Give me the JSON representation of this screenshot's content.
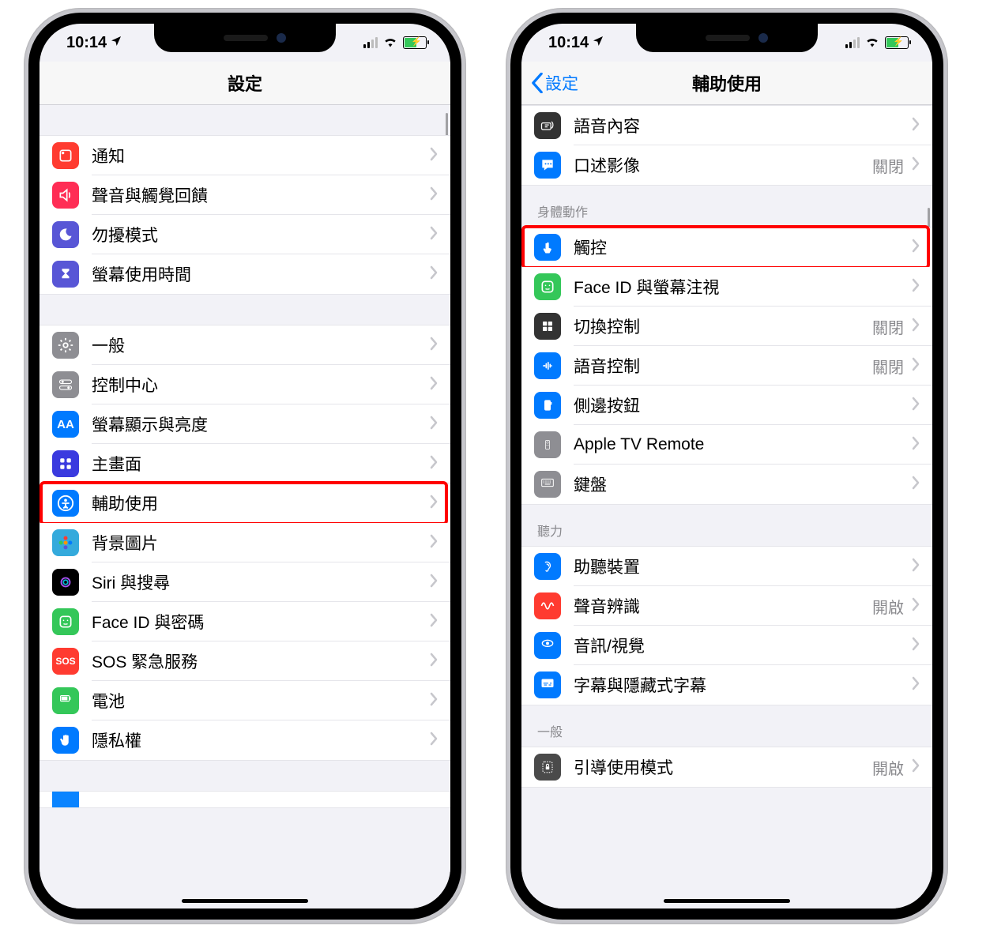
{
  "status": {
    "time": "10:14"
  },
  "left": {
    "title": "設定",
    "rows": [
      {
        "id": "notifications",
        "label": "通知",
        "iconColor": "#ff3b30",
        "glyph": "square"
      },
      {
        "id": "sounds",
        "label": "聲音與觸覺回饋",
        "iconColor": "#ff2d55",
        "glyph": "speaker"
      },
      {
        "id": "dnd",
        "label": "勿擾模式",
        "iconColor": "#5856d6",
        "glyph": "moon"
      },
      {
        "id": "screentime",
        "label": "螢幕使用時間",
        "iconColor": "#5856d6",
        "glyph": "hourglass"
      }
    ],
    "rows2": [
      {
        "id": "general",
        "label": "一般",
        "iconColor": "#8e8e93",
        "glyph": "gear"
      },
      {
        "id": "controlcenter",
        "label": "控制中心",
        "iconColor": "#8e8e93",
        "glyph": "switches"
      },
      {
        "id": "display",
        "label": "螢幕顯示與亮度",
        "iconColor": "#007aff",
        "glyph": "AA"
      },
      {
        "id": "homescreen",
        "label": "主畫面",
        "iconColor": "#3a3adf",
        "glyph": "grid"
      },
      {
        "id": "accessibility",
        "label": "輔助使用",
        "iconColor": "#007aff",
        "glyph": "person",
        "highlight": true
      },
      {
        "id": "wallpaper",
        "label": "背景圖片",
        "iconColor": "#34aadc",
        "glyph": "flower"
      },
      {
        "id": "siri",
        "label": "Siri 與搜尋",
        "iconColor": "#000000",
        "glyph": "siri"
      },
      {
        "id": "faceid",
        "label": "Face ID 與密碼",
        "iconColor": "#34c759",
        "glyph": "face"
      },
      {
        "id": "sos",
        "label": "SOS 緊急服務",
        "iconColor": "#ff3b30",
        "glyph": "SOS"
      },
      {
        "id": "battery",
        "label": "電池",
        "iconColor": "#34c759",
        "glyph": "battery"
      },
      {
        "id": "privacy",
        "label": "隱私權",
        "iconColor": "#007aff",
        "glyph": "hand"
      }
    ]
  },
  "right": {
    "title": "輔助使用",
    "back": "設定",
    "topRows": [
      {
        "id": "spoken",
        "label": "語音內容",
        "iconColor": "#333333",
        "glyph": "voice"
      },
      {
        "id": "audiodesc",
        "label": "口述影像",
        "iconColor": "#007aff",
        "glyph": "bubble",
        "detail": "關閉"
      }
    ],
    "section1": "身體動作",
    "rows1": [
      {
        "id": "touch",
        "label": "觸控",
        "iconColor": "#007aff",
        "glyph": "touch",
        "highlight": true
      },
      {
        "id": "faceattn",
        "label": "Face ID 與螢幕注視",
        "iconColor": "#34c759",
        "glyph": "face"
      },
      {
        "id": "switch",
        "label": "切換控制",
        "iconColor": "#333333",
        "glyph": "grid4",
        "detail": "關閉"
      },
      {
        "id": "voicecontrol",
        "label": "語音控制",
        "iconColor": "#007aff",
        "glyph": "voicewave",
        "detail": "關閉"
      },
      {
        "id": "sidebutton",
        "label": "側邊按鈕",
        "iconColor": "#007aff",
        "glyph": "side"
      },
      {
        "id": "appletv",
        "label": "Apple TV Remote",
        "iconColor": "#8e8e93",
        "glyph": "remote"
      },
      {
        "id": "keyboard",
        "label": "鍵盤",
        "iconColor": "#8e8e93",
        "glyph": "keyboard"
      }
    ],
    "section2": "聽力",
    "rows2": [
      {
        "id": "hearing",
        "label": "助聽裝置",
        "iconColor": "#007aff",
        "glyph": "ear"
      },
      {
        "id": "soundrecog",
        "label": "聲音辨識",
        "iconColor": "#ff3b30",
        "glyph": "wave",
        "detail": "開啟"
      },
      {
        "id": "audiovisual",
        "label": "音訊/視覺",
        "iconColor": "#007aff",
        "glyph": "eye"
      },
      {
        "id": "subtitles",
        "label": "字幕與隱藏式字幕",
        "iconColor": "#007aff",
        "glyph": "cc"
      }
    ],
    "section3": "一般",
    "rows3": [
      {
        "id": "guided",
        "label": "引導使用模式",
        "iconColor": "#4a4a4a",
        "glyph": "lock",
        "detail": "開啟"
      }
    ]
  }
}
